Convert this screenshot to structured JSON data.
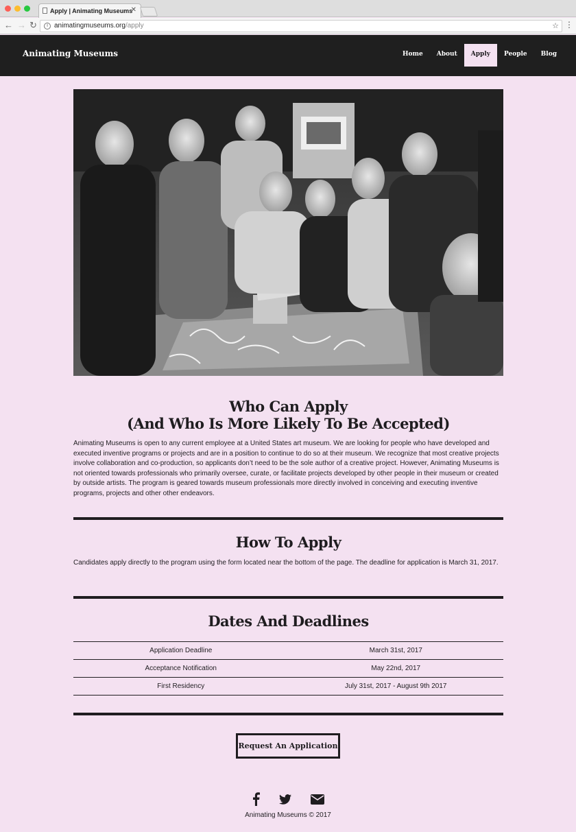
{
  "browser": {
    "tab_title": "Apply | Animating Museums",
    "url_host": "animatingmuseums.org",
    "url_path": "/apply"
  },
  "site": {
    "brand": "Animating Museums",
    "nav": [
      "Home",
      "About",
      "Apply",
      "People",
      "Blog"
    ],
    "active_nav": "Apply"
  },
  "who": {
    "title_line1": "Who Can Apply",
    "title_line2": "(And Who Is More Likely To Be Accepted)",
    "body": "Animating Museums is open to any current employee at a United States art museum. We are looking for people who have developed and executed inventive programs or projects and are in a position to continue to do so at their museum. We recognize that most creative projects involve collaboration and co-production, so applicants don’t need to be the sole author of a creative project. However, Animating Museums is not oriented towards professionals who primarily oversee, curate, or facilitate projects developed by other people in their museum or created by outside artists. The program is geared towards museum professionals more directly involved in conceiving and executing inventive programs, projects and other other endeavors."
  },
  "how": {
    "title": "How To Apply",
    "body": "Candidates apply directly to the program using the form located near the bottom of the page. The deadline for application is March 31, 2017."
  },
  "dates": {
    "title": "Dates And Deadlines",
    "rows": [
      {
        "label": "Application Deadline",
        "value": "March 31st, 2017"
      },
      {
        "label": "Acceptance Notification",
        "value": "May 22nd, 2017"
      },
      {
        "label": "First Residency",
        "value": "July 31st, 2017 - August 9th 2017"
      }
    ]
  },
  "cta": {
    "label": "Request An Application"
  },
  "footer": {
    "text": "Animating Museums © 2017"
  },
  "icons": {
    "facebook": "facebook-icon",
    "twitter": "twitter-icon",
    "email": "email-icon"
  },
  "colors": {
    "page_bg": "#f4e1f1",
    "nav_bg": "#1f1f1f",
    "text": "#1f1d20"
  }
}
